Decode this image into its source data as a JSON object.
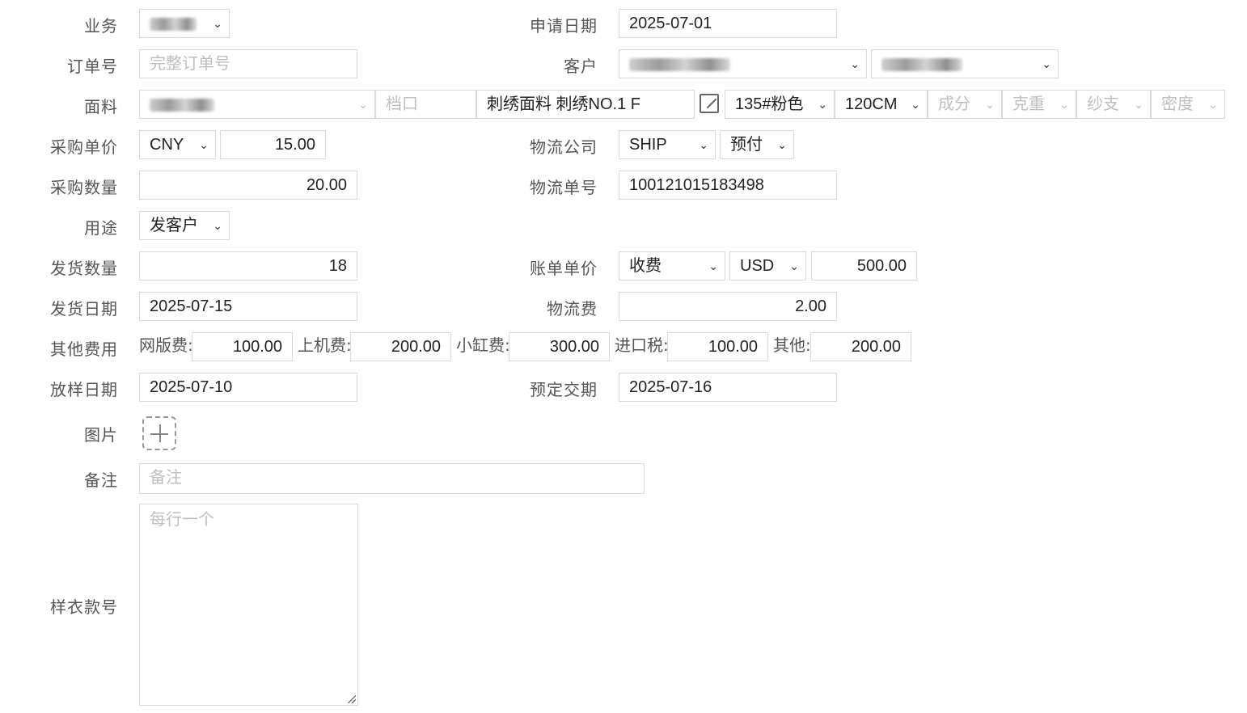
{
  "labels": {
    "business": "业务",
    "order_no": "订单号",
    "fabric": "面料",
    "purchase_price": "采购单价",
    "purchase_qty": "采购数量",
    "usage": "用途",
    "ship_qty": "发货数量",
    "ship_date": "发货日期",
    "other_fees": "其他费用",
    "sample_date": "放样日期",
    "picture": "图片",
    "remark": "备注",
    "sample_style_no": "样衣款号",
    "apply_date": "申请日期",
    "customer": "客户",
    "logistics_company": "物流公司",
    "tracking_no": "物流单号",
    "bill_price": "账单单价",
    "logistics_fee": "物流费",
    "delivery_date": "预定交期"
  },
  "fields": {
    "order_no_placeholder": "完整订单号",
    "stall_placeholder": "档口",
    "fabric_name": "刺绣面料  刺绣NO.1 F",
    "color": "135#粉色",
    "width": "120CM",
    "composition_placeholder": "成分",
    "weight_placeholder": "克重",
    "yarn_placeholder": "纱支",
    "density_placeholder": "密度",
    "currency": "CNY",
    "purchase_price": "15.00",
    "purchase_qty": "20.00",
    "usage": "发客户",
    "ship_qty": "18",
    "ship_date": "2025-07-15",
    "sample_date": "2025-07-10",
    "remark_placeholder": "备注",
    "style_no_placeholder": "每行一个",
    "apply_date": "2025-07-01",
    "logistics_company": "SHIP",
    "payment_type": "预付",
    "tracking_no": "100121015183498",
    "bill_type": "收费",
    "bill_currency": "USD",
    "bill_price": "500.00",
    "logistics_fee": "2.00",
    "delivery_date": "2025-07-16"
  },
  "other_fees": [
    {
      "label": "网版费:",
      "value": "100.00"
    },
    {
      "label": "上机费:",
      "value": "200.00"
    },
    {
      "label": "小缸费:",
      "value": "300.00"
    },
    {
      "label": "进口税:",
      "value": "100.00"
    },
    {
      "label": "其他:",
      "value": "200.00"
    }
  ],
  "icons": {
    "chevron": "⌄",
    "edit": "edit-icon",
    "upload": "plus-icon"
  }
}
